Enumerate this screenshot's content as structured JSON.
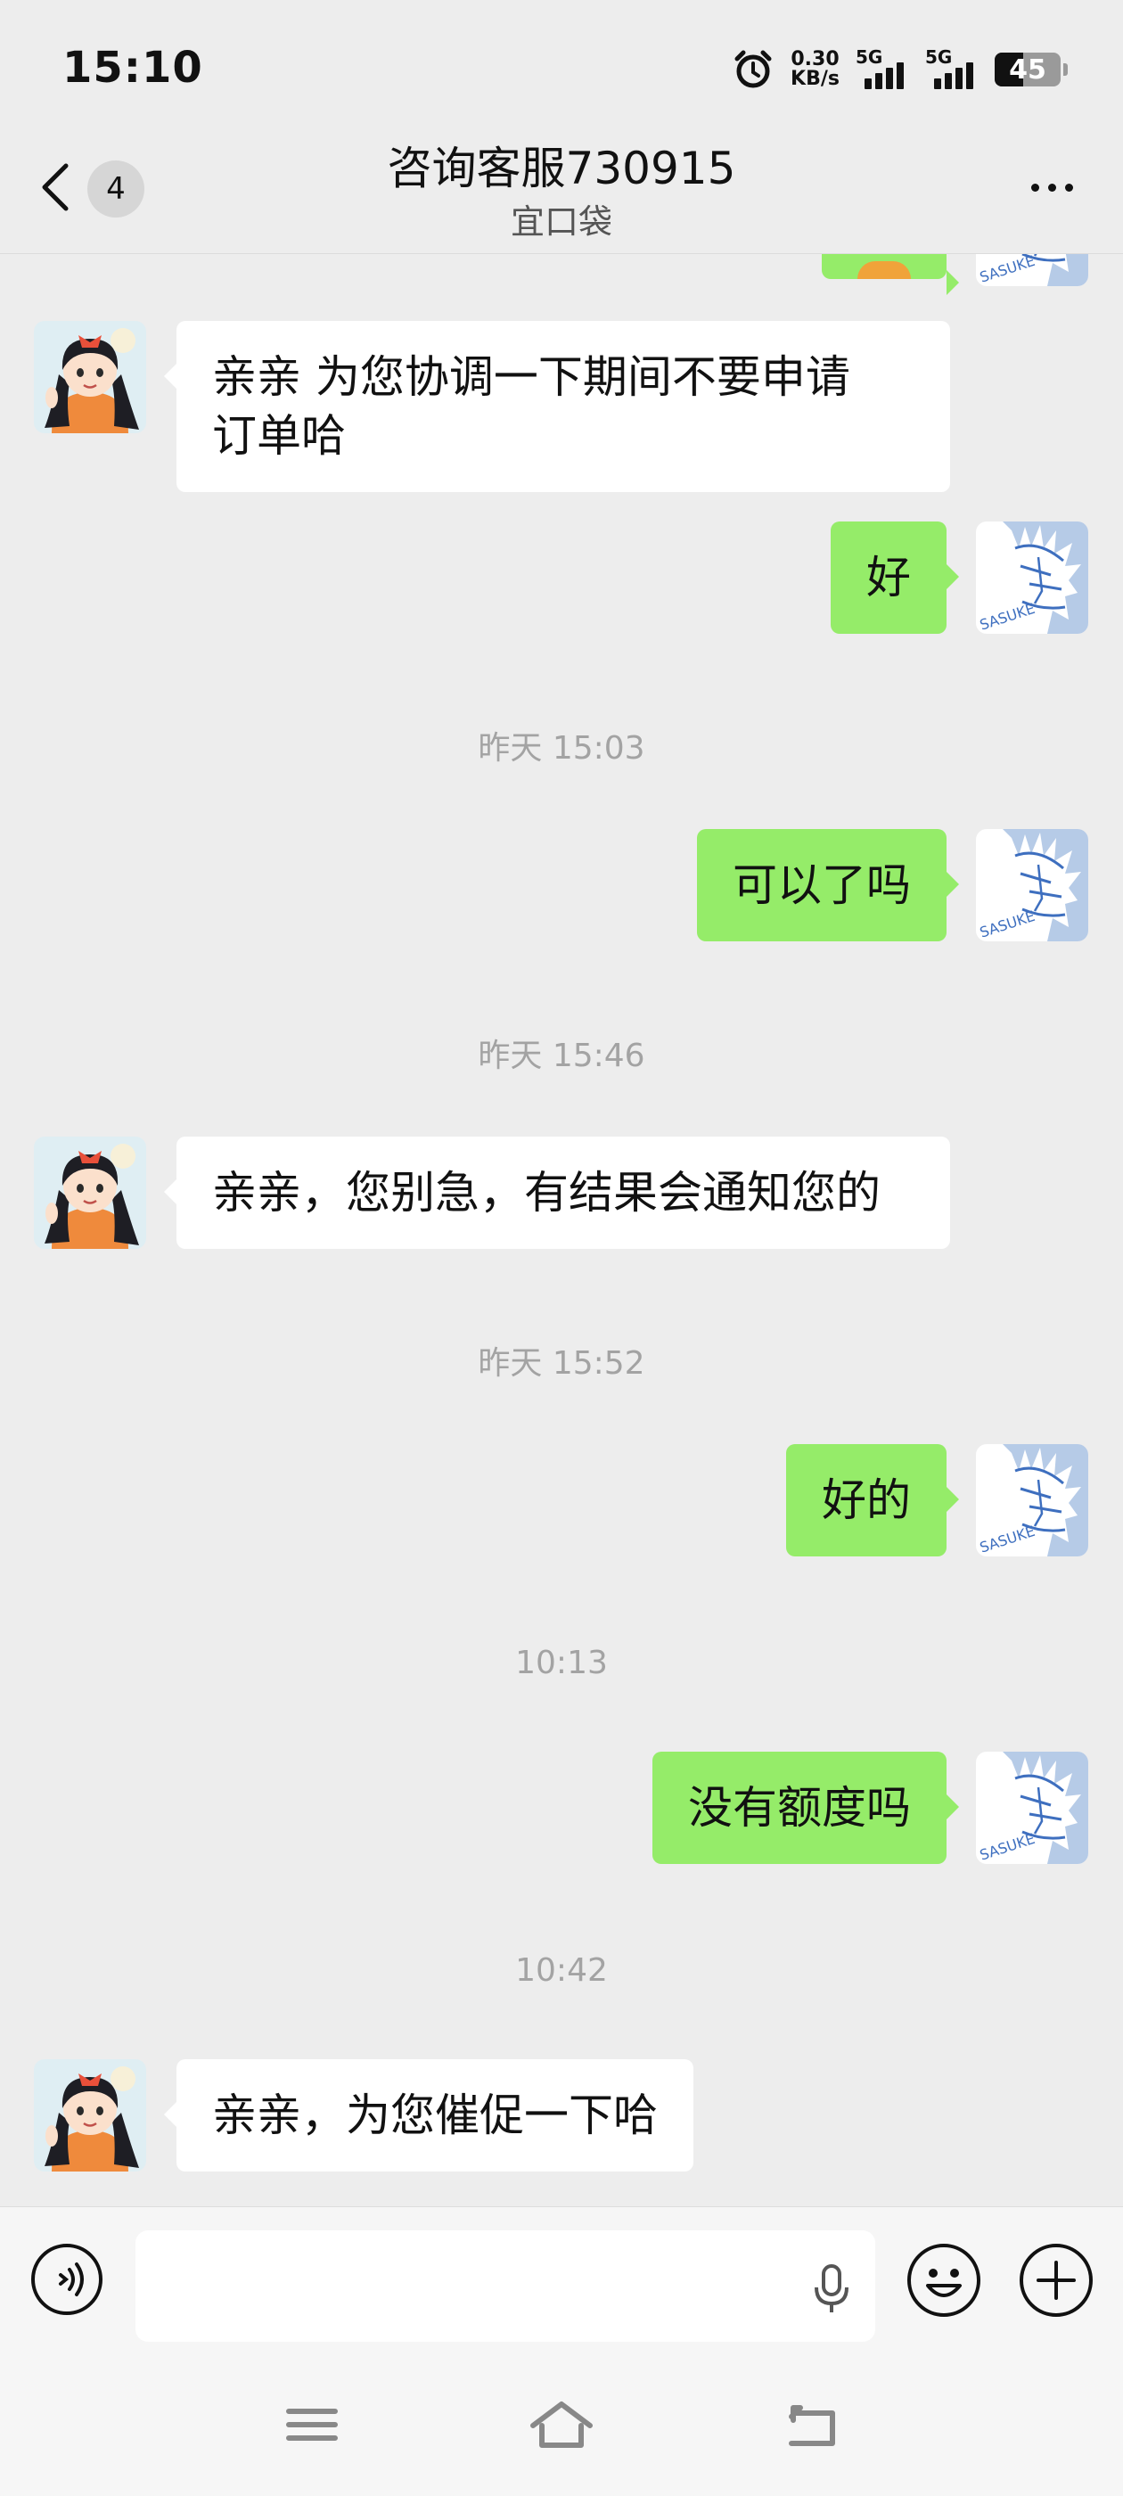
{
  "status_bar": {
    "time": "15:10",
    "net_speed_value": "0.30",
    "net_speed_unit": "KB/s",
    "sim1": "5G",
    "sim2": "5G",
    "battery": "45"
  },
  "header": {
    "unread_count": "4",
    "title": "咨询客服730915",
    "subtitle": "宜口袋"
  },
  "messages": [
    {
      "text_line1": "亲亲 为您协调一下期间不要申请",
      "text_line2": "订单哈"
    },
    {
      "text": "好"
    },
    {
      "time": "昨天 15:03"
    },
    {
      "text": "可以了吗"
    },
    {
      "time": "昨天 15:46"
    },
    {
      "text": "亲亲，您别急，有结果会通知您的"
    },
    {
      "time": "昨天 15:52"
    },
    {
      "text": "好的"
    },
    {
      "time": "10:13"
    },
    {
      "text": "没有额度吗"
    },
    {
      "time": "10:42"
    },
    {
      "text": "亲亲，为您催促一下哈"
    }
  ],
  "colors": {
    "background": "#ededed",
    "outgoing_bubble": "#95ec69",
    "incoming_bubble": "#ffffff",
    "timestamp": "#a3a3a3"
  },
  "icons": [
    "alarm-icon",
    "back-chevron-icon",
    "more-dots-icon",
    "voice-icon",
    "mic-icon",
    "emoji-icon",
    "plus-icon",
    "menu-icon",
    "home-icon",
    "back-icon"
  ]
}
